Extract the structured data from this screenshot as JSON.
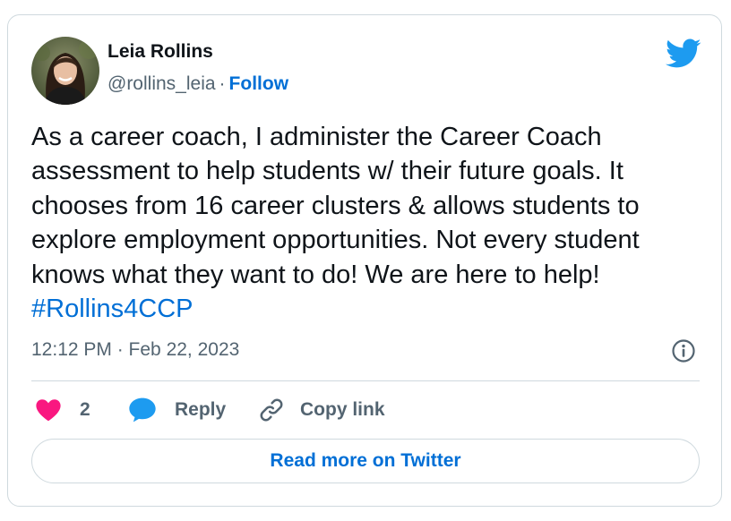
{
  "author": {
    "name": "Leia Rollins",
    "handle": "@rollins_leia",
    "separator": "·",
    "follow_label": "Follow"
  },
  "tweet": {
    "text": "As a career coach, I administer the Career Coach\nassessment to help students w/ their future goals. It\nchooses from 16 career clusters & allows students to\nexplore employment opportunities. Not every student\nknows what they want to do! We are here to help!",
    "hashtag": "#Rollins4CCP",
    "timestamp": "12:12 PM · Feb 22, 2023"
  },
  "actions": {
    "like_count": "2",
    "reply_label": "Reply",
    "copy_label": "Copy link"
  },
  "read_more_label": "Read more on Twitter",
  "icons": {
    "brand": "twitter-bird-icon",
    "info": "info-icon",
    "like": "heart-icon",
    "reply": "speech-bubble-icon",
    "copy": "link-icon"
  },
  "colors": {
    "twitter_blue": "#1d9bf0",
    "link_blue": "#006fd6",
    "heart_pink": "#f91880",
    "muted_text": "#536471",
    "border": "#cfd9de"
  }
}
